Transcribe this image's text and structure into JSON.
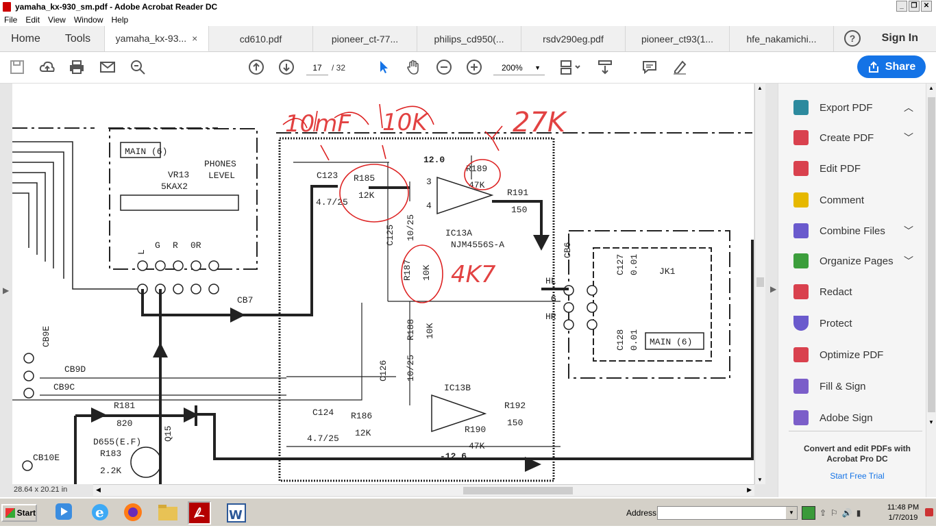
{
  "window": {
    "title": "yamaha_kx-930_sm.pdf - Adobe Acrobat Reader DC"
  },
  "menu": [
    "File",
    "Edit",
    "View",
    "Window",
    "Help"
  ],
  "tabs": {
    "home": "Home",
    "tools": "Tools",
    "docs": [
      {
        "label": "yamaha_kx-93...",
        "active": true
      },
      {
        "label": "cd610.pdf"
      },
      {
        "label": "pioneer_ct-77..."
      },
      {
        "label": "philips_cd950(..."
      },
      {
        "label": "rsdv290eg.pdf"
      },
      {
        "label": "pioneer_ct93(1..."
      },
      {
        "label": "hfe_nakamichi..."
      }
    ],
    "close_glyph": "×",
    "sign_in": "Sign In",
    "help": "?"
  },
  "toolbar": {
    "page_current": "17",
    "page_total": "/ 32",
    "zoom": "200%",
    "share": "Share"
  },
  "status": {
    "dimensions": "28.64 x 20.21 in"
  },
  "schematic": {
    "handwritten": [
      "10mF",
      "10K",
      "27K",
      "4K7"
    ],
    "labels": [
      "MAIN (6)",
      "VR13",
      "5KAX2",
      "PHONES",
      "LEVEL",
      "C123",
      "4.7/25",
      "R185",
      "12K",
      "12.0",
      "R189",
      "47K",
      "R191",
      "150",
      "IC13A",
      "NJM4556S-A",
      "C125",
      "10/25",
      "R187",
      "10K",
      "CB6",
      "C127",
      "0.01",
      "JK1",
      "HL",
      "G",
      "HR",
      "C128",
      "0.01",
      "MAIN (6)",
      "CB7",
      "CB9E",
      "CB9D",
      "CB9C",
      "R188",
      "10K",
      "C126",
      "10/25",
      "IC13B",
      "R192",
      "150",
      "C124",
      "4.7/25",
      "R186",
      "12K",
      "R190",
      "47K",
      "-12.6",
      "R181",
      "820",
      "D655(E.F)",
      "R183",
      "2.2K",
      "CB10E",
      "Q15",
      "0L",
      "L",
      "G",
      "R",
      "0R"
    ]
  },
  "right_panel": {
    "items": [
      {
        "label": "Export PDF",
        "chevron": "︿",
        "color": "#2d8a9e"
      },
      {
        "label": "Create PDF",
        "chevron": "﹀",
        "color": "#d9414e"
      },
      {
        "label": "Edit PDF",
        "chevron": "",
        "color": "#d9414e"
      },
      {
        "label": "Comment",
        "chevron": "",
        "color": "#e6b800"
      },
      {
        "label": "Combine Files",
        "chevron": "﹀",
        "color": "#6a5acd"
      },
      {
        "label": "Organize Pages",
        "chevron": "﹀",
        "color": "#3c9e3c"
      },
      {
        "label": "Redact",
        "chevron": "",
        "color": "#d9414e"
      },
      {
        "label": "Protect",
        "chevron": "",
        "color": "#6a5acd"
      },
      {
        "label": "Optimize PDF",
        "chevron": "",
        "color": "#d9414e"
      },
      {
        "label": "Fill & Sign",
        "chevron": "",
        "color": "#7b5ec9"
      },
      {
        "label": "Adobe Sign",
        "chevron": "",
        "color": "#7b5ec9"
      }
    ],
    "promo": "Convert and edit PDFs with Acrobat Pro DC",
    "trial": "Start Free Trial"
  },
  "taskbar": {
    "start": "Start",
    "address_label": "Address",
    "time": "11:48 PM",
    "date": "1/7/2019"
  }
}
